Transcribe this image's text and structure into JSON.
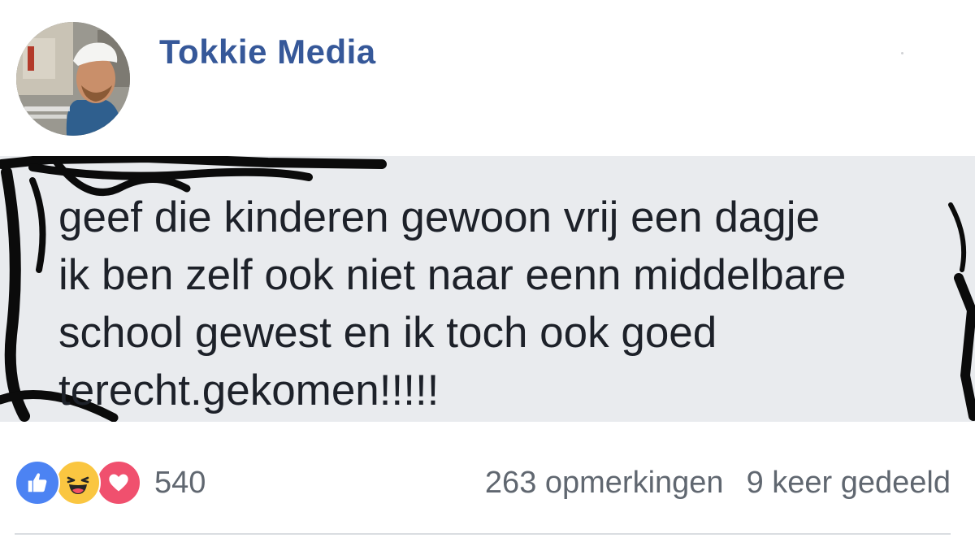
{
  "post": {
    "page_name": "Tokkie Media",
    "text": "geef die kinderen gewoon vrij een dagje\nik ben zelf ook niet naar eenn middelbare\nschool gewest en ik toch ook goed\nterecht.gekomen!!!!!"
  },
  "reactions": {
    "icons": [
      "like-icon",
      "haha-icon",
      "love-icon"
    ],
    "count": "540"
  },
  "engagement": {
    "comments": "263 opmerkingen",
    "shares": "9 keer gedeeld"
  },
  "colors": {
    "page_name": "#365899",
    "panel_bg": "#e9ebee",
    "meta_text": "#606770",
    "like": "#4c83f3",
    "haha": "#fac641",
    "love": "#f0506e"
  }
}
